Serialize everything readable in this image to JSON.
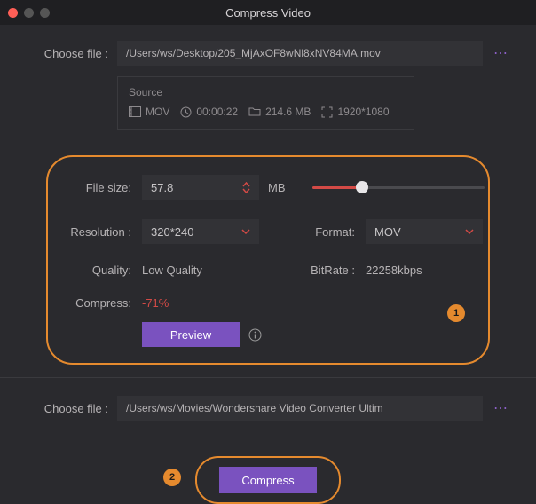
{
  "window": {
    "title": "Compress Video"
  },
  "choose_file_label": "Choose file :",
  "input_path": "/Users/ws/Desktop/205_MjAxOF8wNl8xNV84MA.mov",
  "source": {
    "heading": "Source",
    "format": "MOV",
    "duration": "00:00:22",
    "size": "214.6 MB",
    "resolution": "1920*1080"
  },
  "settings": {
    "file_size_label": "File size:",
    "file_size_value": "57.8",
    "file_size_unit": "MB",
    "slider_pct": 29,
    "resolution_label": "Resolution :",
    "resolution_value": "320*240",
    "format_label": "Format:",
    "format_value": "MOV",
    "quality_label": "Quality:",
    "quality_value": "Low Quality",
    "bitrate_label": "BitRate :",
    "bitrate_value": "22258kbps",
    "compress_label": "Compress:",
    "compress_value": "-71%",
    "preview_label": "Preview"
  },
  "output_path": "/Users/ws/Movies/Wondershare Video Converter Ultim",
  "compress_button": "Compress",
  "annotations": {
    "badge1": "1",
    "badge2": "2"
  },
  "colors": {
    "accent": "#7a52bf",
    "highlight": "#e58a2e",
    "danger": "#d34a46"
  }
}
